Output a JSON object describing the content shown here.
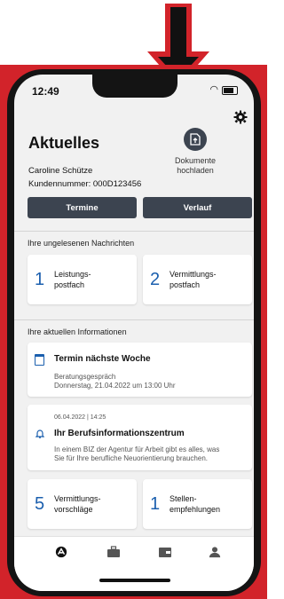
{
  "status": {
    "time": "12:49"
  },
  "header": {
    "title": "Aktuelles",
    "upload_label_line1": "Dokumente",
    "upload_label_line2": "hochladen"
  },
  "user": {
    "name": "Caroline Schütze",
    "customer_number": "Kundennummer: 000D123456"
  },
  "actions": {
    "termine_label": "Termine",
    "verlauf_label": "Verlauf"
  },
  "messages": {
    "heading": "Ihre ungelesenen Nachrichten",
    "cards": [
      {
        "count": "1",
        "line1": "Leistungs-",
        "line2": "postfach"
      },
      {
        "count": "2",
        "line1": "Vermittlungs-",
        "line2": "postfach"
      }
    ]
  },
  "info": {
    "heading": "Ihre aktuellen Informationen",
    "appointment": {
      "title": "Termin nächste Woche",
      "type": "Beratungsgespräch",
      "datetime": "Donnerstag, 21.04.2022 um 13:00 Uhr"
    },
    "notice": {
      "date": "06.04.2022 | 14:25",
      "title": "Ihr Berufsinformationszentrum",
      "text_line1": "In einem BIZ der Agentur für Arbeit gibt es alles, was",
      "text_line2": "Sie für Ihre berufliche Neuorientierung brauchen."
    },
    "cards": [
      {
        "count": "5",
        "line1": "Vermittlungs-",
        "line2": "vorschläge"
      },
      {
        "count": "1",
        "line1": "Stellen-",
        "line2": "empfehlungen"
      }
    ]
  },
  "nav": {
    "items": [
      "home-icon",
      "briefcase-icon",
      "wallet-icon",
      "person-icon"
    ]
  },
  "colors": {
    "accent": "#1b5fae",
    "button": "#3c4450",
    "frame": "#d2232a"
  }
}
